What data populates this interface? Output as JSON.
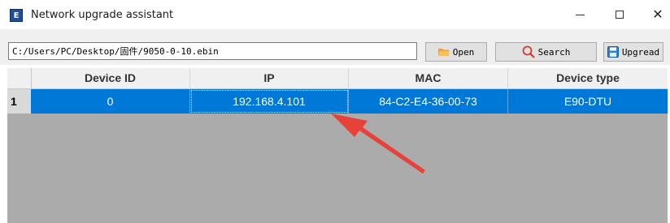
{
  "window": {
    "app_icon_text": "E",
    "title": "Network upgrade assistant",
    "minimize_glyph": "—",
    "maximize_glyph": "☐",
    "close_glyph": "✕"
  },
  "toolbar": {
    "file_path": "C:/Users/PC/Desktop/固件/9050-0-10.ebin",
    "open_label": "Open",
    "search_label": "Search",
    "upgrade_label": "Upgread"
  },
  "grid": {
    "columns": [
      "Device ID",
      "IP",
      "MAC",
      "Device type"
    ],
    "rows": [
      {
        "row_number": "1",
        "cells": [
          "0",
          "192.168.4.101",
          "84-C2-E4-36-00-73",
          "E90-DTU"
        ]
      }
    ]
  },
  "colors": {
    "selection": "#0078d7",
    "annotation_arrow": "#e8413a"
  },
  "icons": {
    "open": "folder-icon",
    "search": "magnifier-icon",
    "upgrade": "save-icon",
    "annotation": "arrow-annotation"
  }
}
